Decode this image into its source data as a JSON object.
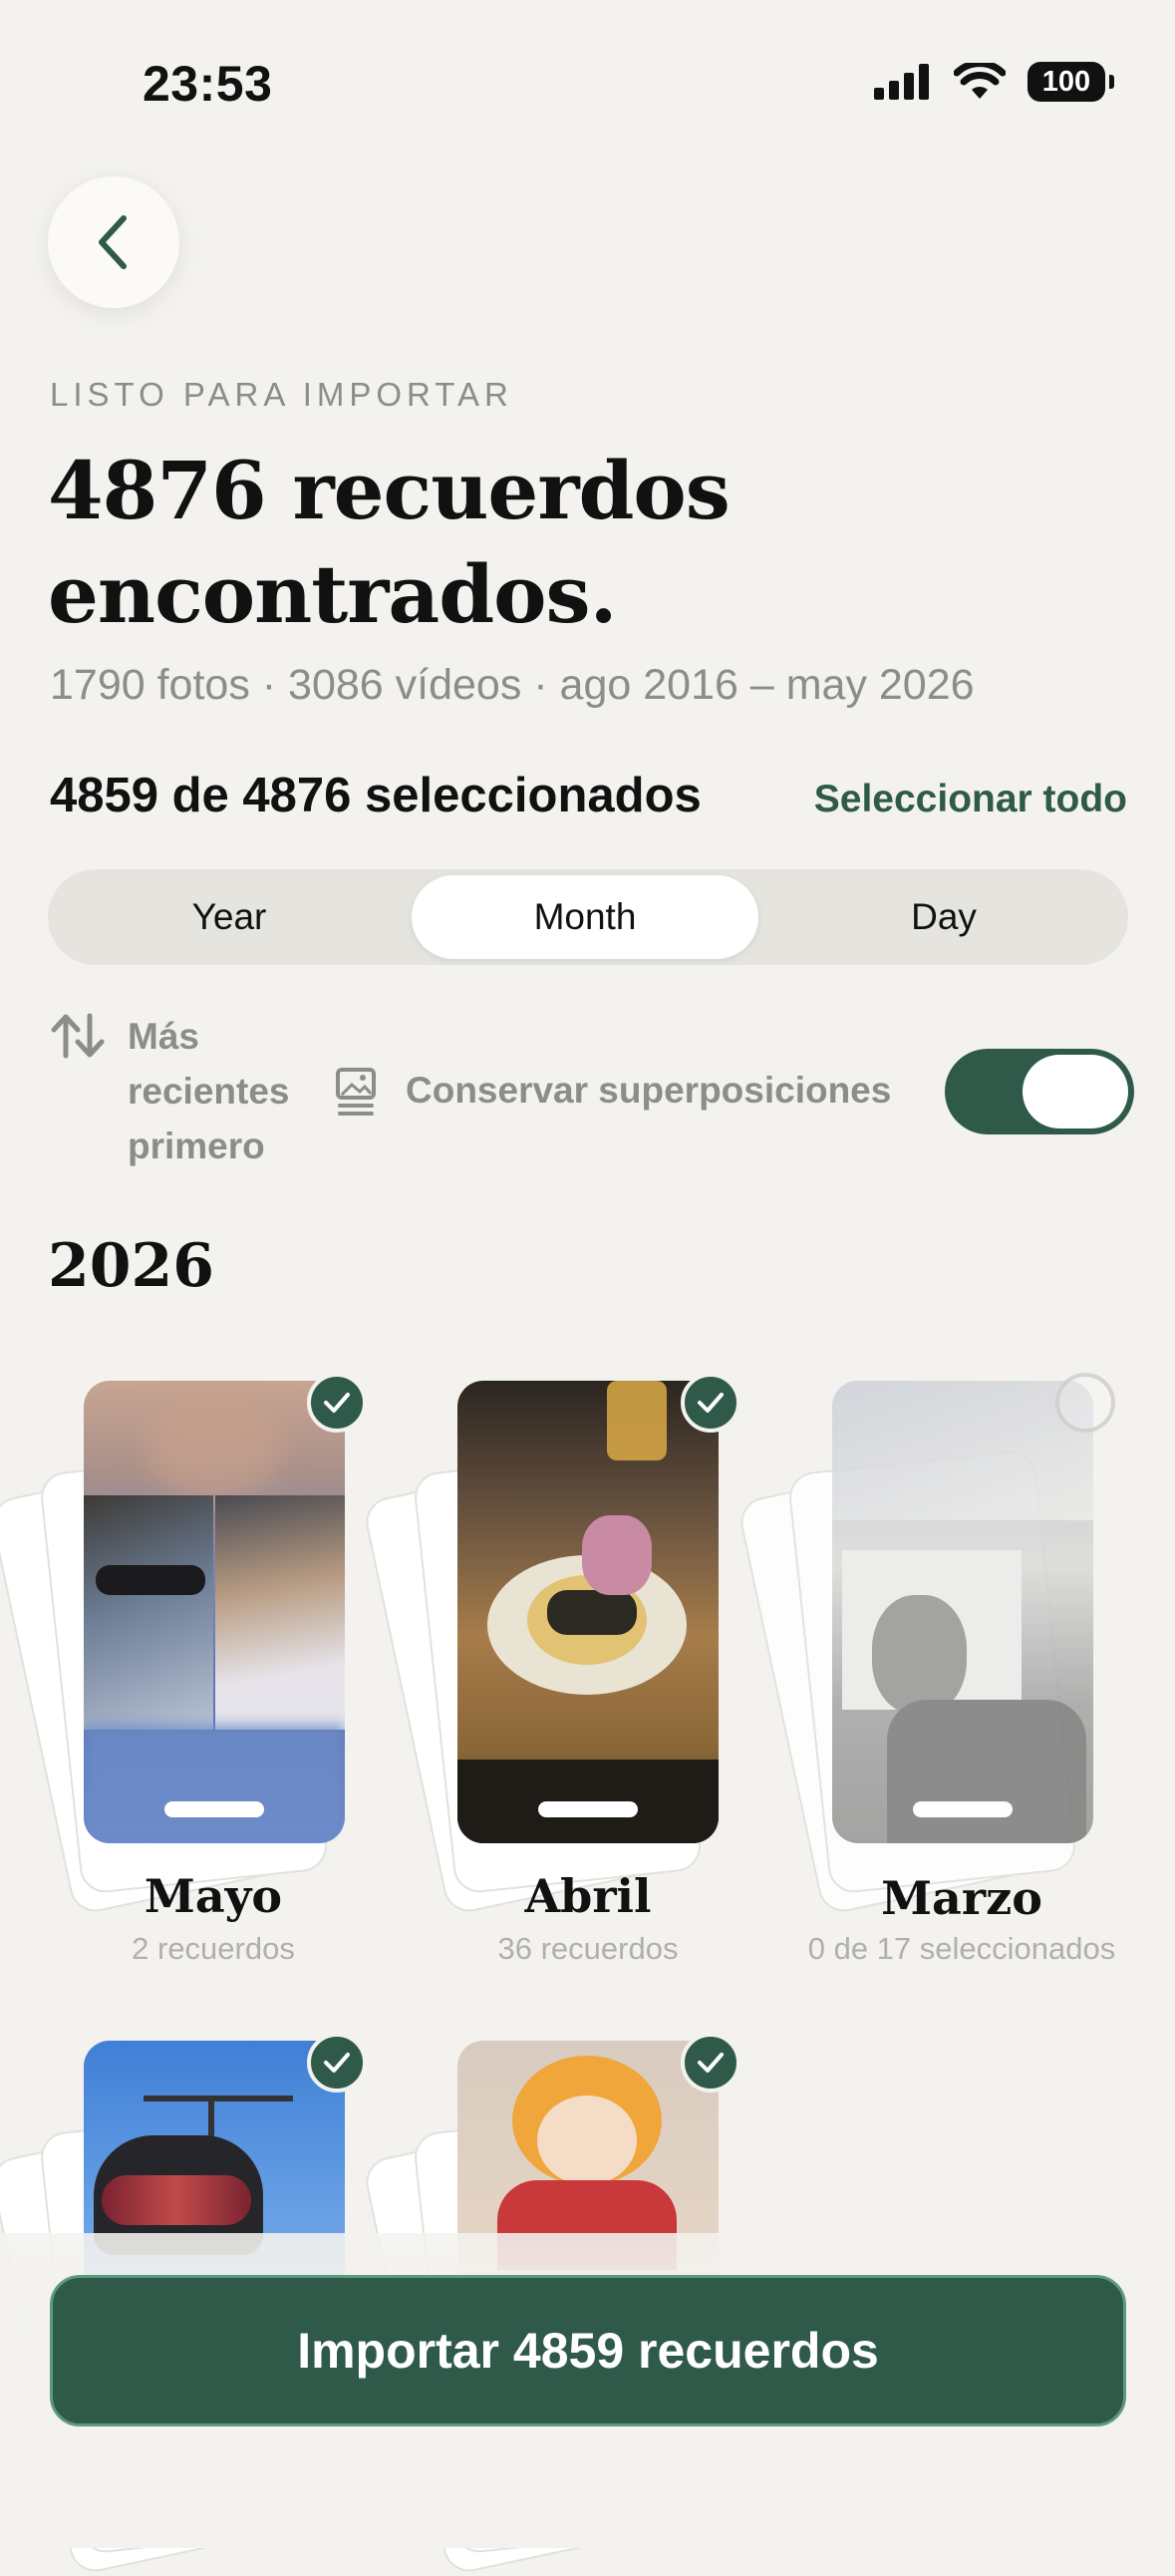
{
  "status_bar": {
    "time": "23:53",
    "battery": "100"
  },
  "header": {
    "eyebrow": "LISTO PARA IMPORTAR",
    "title_line1": "4876 recuerdos",
    "title_line2": "encontrados.",
    "subtitle": "1790 fotos · 3086 vídeos · ago 2016 – may 2026"
  },
  "selection": {
    "count_text": "4859 de 4876 seleccionados",
    "select_all_label": "Seleccionar todo"
  },
  "segmented": {
    "options": [
      "Year",
      "Month",
      "Day"
    ],
    "selected": "Month"
  },
  "options_row": {
    "sort_label": "Más recientes primero",
    "overlay_label": "Conservar superposiciones",
    "overlay_toggle_on": true
  },
  "year_section": {
    "year": "2026",
    "months": [
      {
        "name": "Mayo",
        "sub": "2 recuerdos",
        "selected": true
      },
      {
        "name": "Abril",
        "sub": "36 recuerdos",
        "selected": true
      },
      {
        "name": "Marzo",
        "sub": "0 de 17 seleccionados",
        "selected": false
      },
      {
        "name": "",
        "sub": "",
        "selected": true
      },
      {
        "name": "",
        "sub": "",
        "selected": true
      }
    ]
  },
  "import_button_label": "Importar 4859 recuerdos",
  "colors": {
    "accent": "#2f5a4a",
    "background": "#f3f2ee"
  }
}
